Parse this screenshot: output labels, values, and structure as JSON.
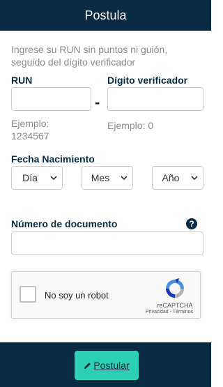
{
  "header": {
    "title": "Postula"
  },
  "form": {
    "instructions": "Ingrese su RUN sin puntos ni guión, seguido del dígito verificador",
    "run": {
      "label": "RUN",
      "hint": "Ejemplo: 1234567",
      "value": ""
    },
    "dv": {
      "label": "Dígito verificador",
      "hint": "Ejemplo: 0",
      "value": ""
    },
    "separator": "-",
    "birthdate": {
      "label": "Fecha Nacimiento",
      "day": "Día",
      "month": "Mes",
      "year": "Año"
    },
    "document": {
      "label": "Número de documento",
      "value": ""
    }
  },
  "recaptcha": {
    "label": "No soy un robot",
    "brand": "reCAPTCHA",
    "links": "Privacidad - Términos"
  },
  "footer": {
    "submit_label": "Postular"
  },
  "colors": {
    "navy": "#082a42",
    "accent": "#2bd1b2",
    "muted": "#8c8c8c"
  },
  "icons": {
    "help": "question-circle-icon",
    "submit": "pencil-icon",
    "select": "chevron-down-icon"
  }
}
